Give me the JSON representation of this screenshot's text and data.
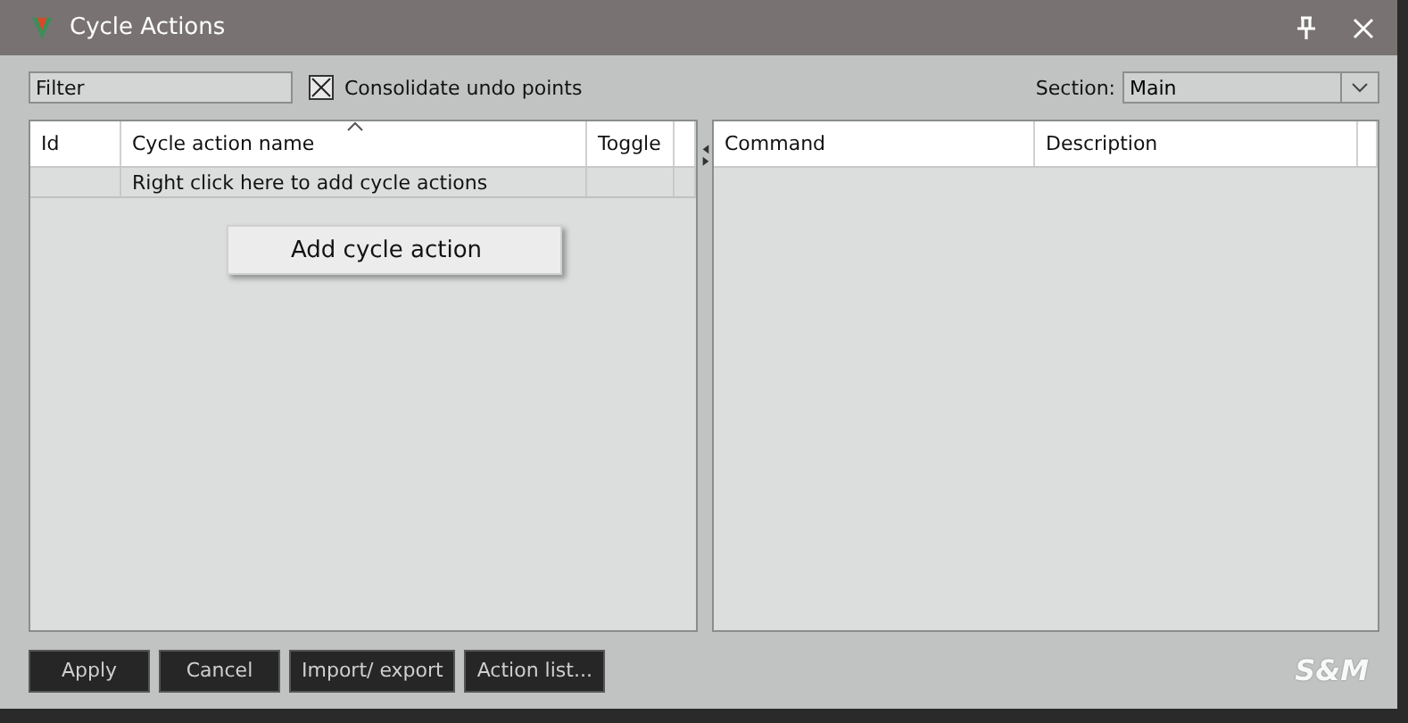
{
  "window": {
    "title": "Cycle Actions"
  },
  "filter": {
    "placeholder": "Filter"
  },
  "consolidate": {
    "label": "Consolidate undo points",
    "checked": true
  },
  "section": {
    "label": "Section:",
    "value": "Main"
  },
  "left_table": {
    "columns": [
      "Id",
      "Cycle action name",
      "Toggle"
    ],
    "rows": [
      [
        "",
        "Right click here to add cycle actions",
        ""
      ]
    ]
  },
  "context_menu": {
    "items": [
      "Add cycle action"
    ]
  },
  "right_table": {
    "columns": [
      "Command",
      "Description"
    ]
  },
  "buttons": [
    "Apply",
    "Cancel",
    "Import/ export",
    "Action list..."
  ],
  "logo": "S&M"
}
